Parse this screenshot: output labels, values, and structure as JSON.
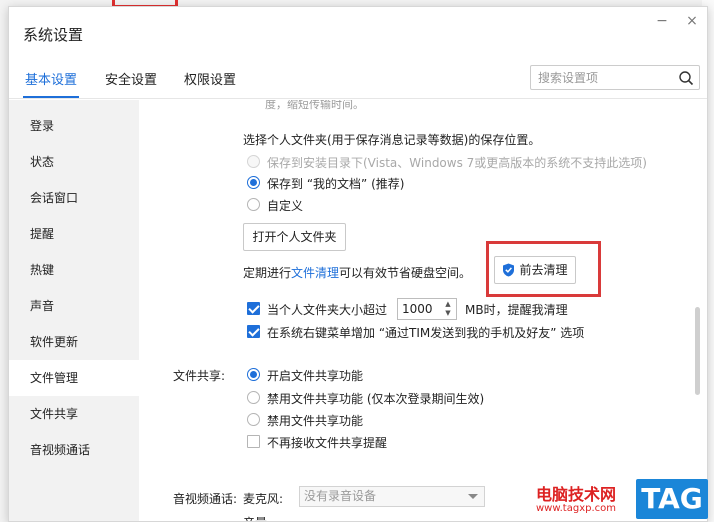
{
  "window": {
    "title": "系统设置",
    "minimize_glyph": "−",
    "close_glyph": "×"
  },
  "tabs": [
    {
      "label": "基本设置",
      "active": true
    },
    {
      "label": "安全设置",
      "active": false
    },
    {
      "label": "权限设置",
      "active": false
    }
  ],
  "search": {
    "placeholder": "搜索设置项",
    "value": ""
  },
  "sidebar": {
    "items": [
      {
        "label": "登录",
        "active": false
      },
      {
        "label": "状态",
        "active": false
      },
      {
        "label": "会话窗口",
        "active": false
      },
      {
        "label": "提醒",
        "active": false
      },
      {
        "label": "热键",
        "active": false
      },
      {
        "label": "声音",
        "active": false
      },
      {
        "label": "软件更新",
        "active": false
      },
      {
        "label": "文件管理",
        "active": true
      },
      {
        "label": "文件共享",
        "active": false
      },
      {
        "label": "音视频通话",
        "active": false
      }
    ]
  },
  "file_management": {
    "cut_text": "度，缩短传输时间。",
    "folder_prompt": "选择个人文件夹(用于保存消息记录等数据)的保存位置。",
    "options": [
      {
        "label": "保存到安装目录下(Vista、Windows 7或更高版本的系统不支持此选项)",
        "state": "disabled"
      },
      {
        "label": "保存到 “我的文档” (推荐)",
        "state": "selected"
      },
      {
        "label": "自定义",
        "state": "unselected"
      }
    ],
    "open_folder_button": "打开个人文件夹",
    "cleanup_prefix": "定期进行",
    "cleanup_link": "文件清理",
    "cleanup_suffix": "可以有效节省硬盘空间。",
    "cleanup_button": "前去清理",
    "size_check_label": "当个人文件夹大小超过",
    "size_value": "1000",
    "size_suffix": "MB时，提醒我清理",
    "size_checked": true,
    "context_menu_label": "在系统右键菜单增加 “通过TIM发送到我的手机及好友” 选项",
    "context_menu_checked": true
  },
  "file_sharing": {
    "section_label": "文件共享:",
    "options": [
      {
        "label": "开启文件共享功能",
        "state": "selected"
      },
      {
        "label": "禁用文件共享功能 (仅本次登录期间生效)",
        "state": "unselected"
      },
      {
        "label": "禁用文件共享功能",
        "state": "unselected"
      }
    ],
    "no_reminder_label": "不再接收文件共享提醒",
    "no_reminder_checked": false
  },
  "av_call": {
    "section_label": "音视频通话:",
    "mic_label": "麦克风:",
    "mic_value": "没有录音设备",
    "next_label": "音量"
  },
  "watermark": {
    "text": "电脑技术网",
    "url": "www.tagxp.com",
    "tag": "TAG"
  },
  "colors": {
    "accent": "#1e6fd9",
    "highlight_box": "#d93a3a"
  }
}
